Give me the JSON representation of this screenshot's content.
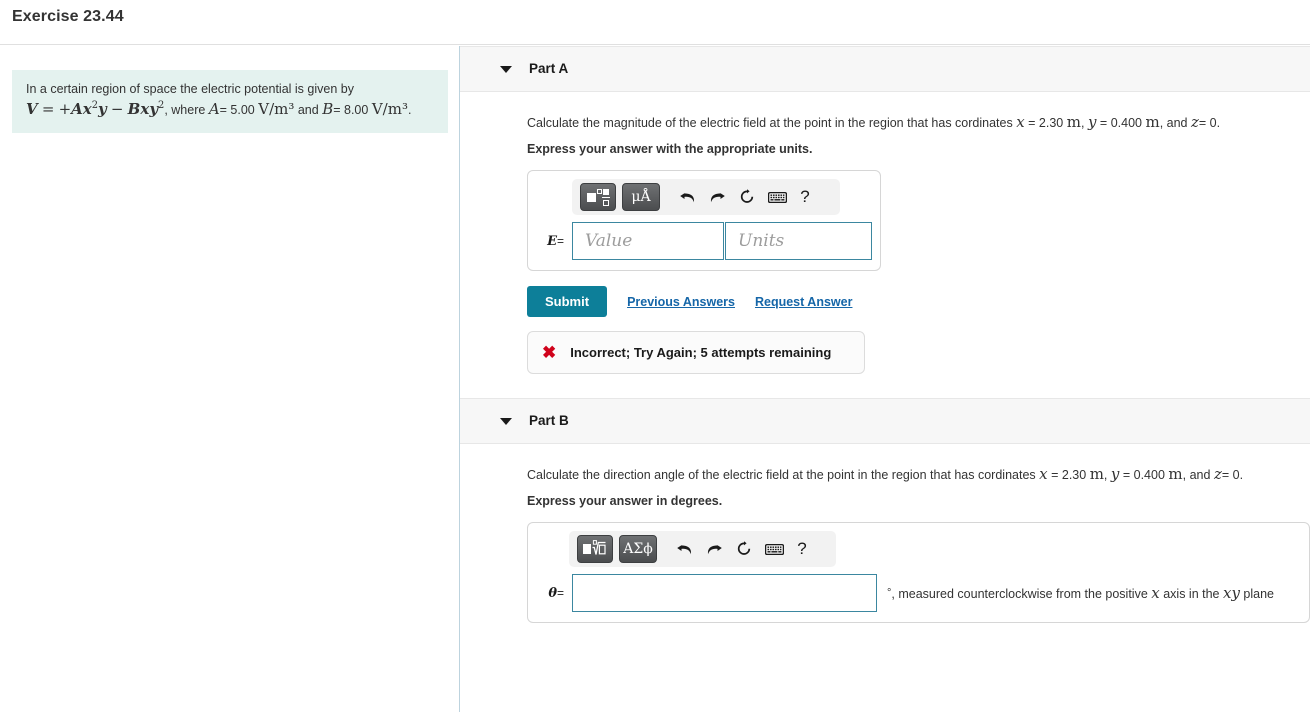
{
  "header": {
    "title": "Exercise 23.44"
  },
  "problem": {
    "line1": "In a certain region of space the electric potential is given by",
    "formula": "V = +Ax²y − Bxy²",
    "where_word": ", where",
    "const_a_name": "A",
    "const_a_value": "= 5.00",
    "const_a_units": "V/m³",
    "and_word": "and",
    "const_b_name": "B",
    "const_b_value": "= 8.00",
    "const_b_units": "V/m³",
    "period": "."
  },
  "parts": {
    "a": {
      "label": "Part A",
      "question": "Calculate the magnitude of the electric field at the point in the region that has cordinates",
      "coord_x": "x",
      "coord_x_val": "= 2.30",
      "coord_x_unit": "m",
      "coord_y": "y",
      "coord_y_val": "= 0.400",
      "coord_y_unit": "m",
      "and_text": ", and",
      "coord_z": "z",
      "coord_z_val": "= 0.",
      "instruction": "Express your answer with the appropriate units.",
      "toolbar": {
        "template_button": "template-icon",
        "units_button": "μÅ",
        "undo": "undo-icon",
        "redo": "redo-icon",
        "reset": "reset-icon",
        "keyboard": "keyboard-icon",
        "help": "?"
      },
      "field_symbol": "E",
      "field_eq": "=",
      "value_placeholder": "Value",
      "value": "",
      "units_placeholder": "Units",
      "units": "",
      "submit_label": "Submit",
      "previous_answers_label": "Previous Answers",
      "request_answer_label": "Request Answer",
      "feedback": {
        "icon": "✖",
        "text": "Incorrect; Try Again; 5 attempts remaining",
        "color": "#d0021b"
      }
    },
    "b": {
      "label": "Part B",
      "question": "Calculate the direction angle of the electric field at the point in the region that has cordinates",
      "coord_x": "x",
      "coord_x_val": "= 2.30",
      "coord_x_unit": "m",
      "coord_y": "y",
      "coord_y_val": "= 0.400",
      "coord_y_unit": "m",
      "and_text": ", and",
      "coord_z": "z",
      "coord_z_val": "= 0.",
      "instruction": "Express your answer in degrees.",
      "toolbar": {
        "template_button": "root-icon",
        "greek_button": "ΑΣϕ",
        "undo": "undo-icon",
        "redo": "redo-icon",
        "reset": "reset-icon",
        "keyboard": "keyboard-icon",
        "help": "?"
      },
      "field_symbol": "θ",
      "field_eq": "=",
      "value": "",
      "suffix_degree": "°",
      "suffix_text": ", measured counterclockwise from the positive",
      "suffix_axis": "x",
      "suffix_mid": "axis in the",
      "suffix_plane": "xy",
      "suffix_end": "plane"
    }
  },
  "colors": {
    "problem_bg": "#e4f2ef",
    "submit_bg": "#0d7f99",
    "link": "#1566a8",
    "input_border": "#3b87a0",
    "error": "#d0021b",
    "part_header_bg": "#f7f7f7",
    "divider": "#bdd3de"
  }
}
